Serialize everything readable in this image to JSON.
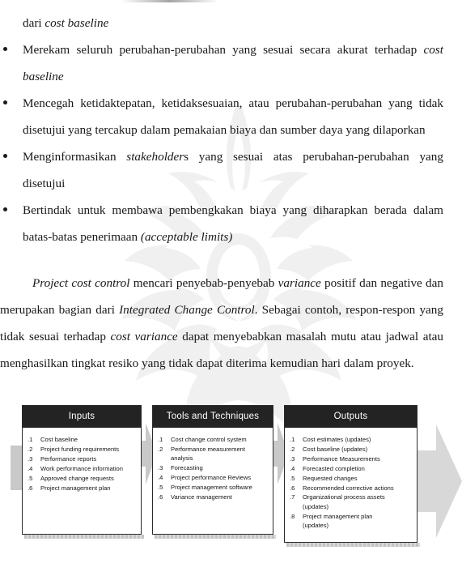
{
  "document": {
    "language": "Indonesian",
    "continuation_line": {
      "plain_before": "dari ",
      "italic": "cost baseline"
    },
    "bullets": [
      {
        "id": "bullet-merekam",
        "segments": [
          {
            "text": "Merekam seluruh perubahan-perubahan yang sesuai  secara akurat terhadap ",
            "italic": false
          },
          {
            "text": "cost baseline",
            "italic": true
          }
        ]
      },
      {
        "id": "bullet-mencegah",
        "segments": [
          {
            "text": "Mencegah ketidaktepatan, ketidaksesuaian, atau perubahan-perubahan yang tidak disetujui yang tercakup dalam pemakaian biaya dan sumber daya yang dilaporkan",
            "italic": false
          }
        ]
      },
      {
        "id": "bullet-menginformasikan",
        "segments": [
          {
            "text": "Menginformasikan ",
            "italic": false
          },
          {
            "text": "stakeholder",
            "italic": true
          },
          {
            "text": "s yang sesuai atas perubahan-perubahan yang disetujui",
            "italic": false
          }
        ]
      },
      {
        "id": "bullet-bertindak",
        "segments": [
          {
            "text": "Bertindak untuk membawa pembengkakan biaya yang diharapkan berada dalam batas-batas penerimaan ",
            "italic": false
          },
          {
            "text": "(acceptable limits)",
            "italic": true
          }
        ]
      }
    ],
    "closing_paragraph": [
      {
        "text": "Project cost control",
        "italic": true
      },
      {
        "text": " mencari penyebab-penyebab ",
        "italic": false
      },
      {
        "text": "variance",
        "italic": true
      },
      {
        "text": " positif dan negative dan merupakan bagian dari ",
        "italic": false
      },
      {
        "text": "Integrated Change Control",
        "italic": true
      },
      {
        "text": ". Sebagai contoh, respon-respon yang tidak sesuai terhadap ",
        "italic": false
      },
      {
        "text": "cost variance",
        "italic": true
      },
      {
        "text": " dapat menyebabkan masalah mutu atau jadwal atau menghasilkan tingkat resiko yang tidak dapat diterima kemudian hari dalam proyek.",
        "italic": false
      }
    ]
  },
  "diagram": {
    "type": "process-itto",
    "boxes": [
      {
        "id": "inputs",
        "header": "Inputs",
        "items": [
          {
            "num": ".1",
            "text": "Cost baseline"
          },
          {
            "num": ".2",
            "text": "Project funding requirements"
          },
          {
            "num": ".3",
            "text": "Performance reports"
          },
          {
            "num": ".4",
            "text": "Work performance information"
          },
          {
            "num": ".5",
            "text": "Approved change requests"
          },
          {
            "num": ".6",
            "text": "Project management plan"
          }
        ]
      },
      {
        "id": "tools",
        "header": "Tools and Techniques",
        "items": [
          {
            "num": ".1",
            "text": "Cost change control system"
          },
          {
            "num": ".2",
            "text": "Performance measurement",
            "sub": "analysis"
          },
          {
            "num": ".3",
            "text": "Forecasting"
          },
          {
            "num": ".4",
            "text": "Project performance Reviews"
          },
          {
            "num": ".5",
            "text": "Project management software"
          },
          {
            "num": ".6",
            "text": "Variance management"
          }
        ]
      },
      {
        "id": "outputs",
        "header": "Outputs",
        "items": [
          {
            "num": ".1",
            "text": "Cost estimates (updates)"
          },
          {
            "num": ".2",
            "text": "Cost baseline (updates)"
          },
          {
            "num": ".3",
            "text": "Performance Measurements"
          },
          {
            "num": ".4",
            "text": "Forecasted completion"
          },
          {
            "num": ".5",
            "text": "Requested changes"
          },
          {
            "num": ".6",
            "text": "Recommended corrective actions"
          },
          {
            "num": ".7",
            "text": "Organizational process assets",
            "sub": "(updates)"
          },
          {
            "num": ".8",
            "text": "Project management plan",
            "sub": "(updates)"
          }
        ]
      }
    ],
    "colors": {
      "header_bg": "#232323",
      "header_text": "#ffffff",
      "box_border": "#2b2b2b",
      "arrow_fill": "#d4d4d4",
      "shadow": "#c4c4c4"
    }
  },
  "watermark": {
    "name": "universitas-indonesia-makara-logo",
    "color": "#c8c8c8"
  }
}
